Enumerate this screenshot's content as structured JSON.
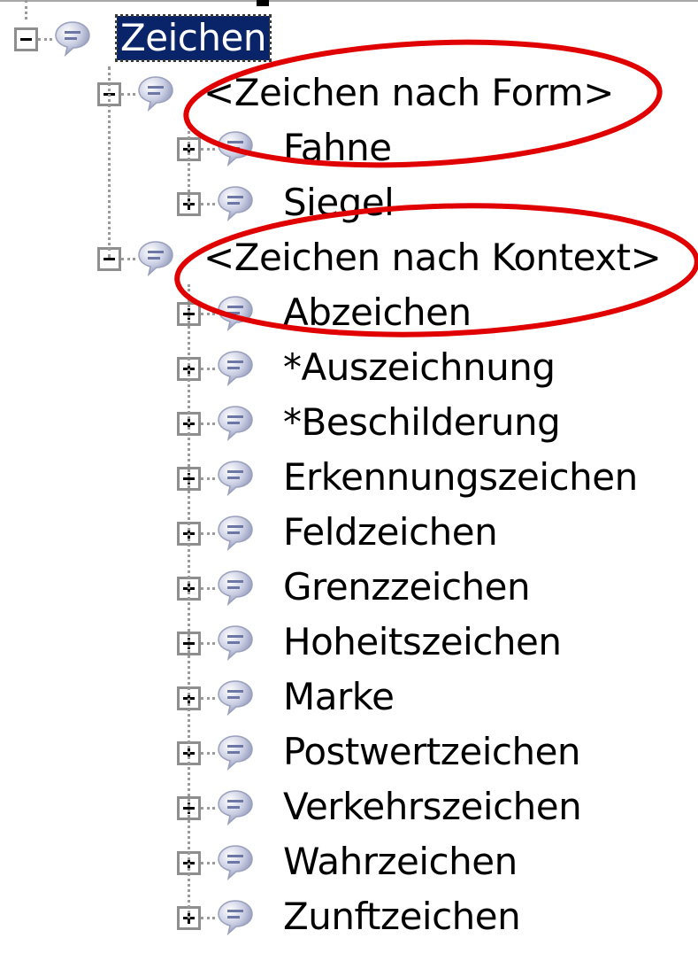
{
  "tree": {
    "root": {
      "label": "Zeichen",
      "expanded": true,
      "selected": true
    },
    "groups": [
      {
        "label": "<Zeichen nach Form>",
        "expanded": true,
        "highlighted": true,
        "items": [
          "Fahne",
          "Siegel"
        ]
      },
      {
        "label": "<Zeichen nach Kontext>",
        "expanded": true,
        "highlighted": true,
        "items": [
          "Abzeichen",
          "*Auszeichnung",
          "*Beschilderung",
          "Erkennungszeichen",
          "Feldzeichen",
          "Grenzzeichen",
          "Hoheitszeichen",
          "Marke",
          "Postwertzeichen",
          "Verkehrszeichen",
          "Wahrzeichen",
          "Zunftzeichen"
        ]
      }
    ]
  },
  "icons": {
    "node": "speech-bubble-icon",
    "collapse": "minus-box-icon",
    "expand": "plus-box-icon"
  },
  "colors": {
    "selection": "#0a246a",
    "annotation": "#e00000",
    "connector": "#9a9a9a"
  }
}
